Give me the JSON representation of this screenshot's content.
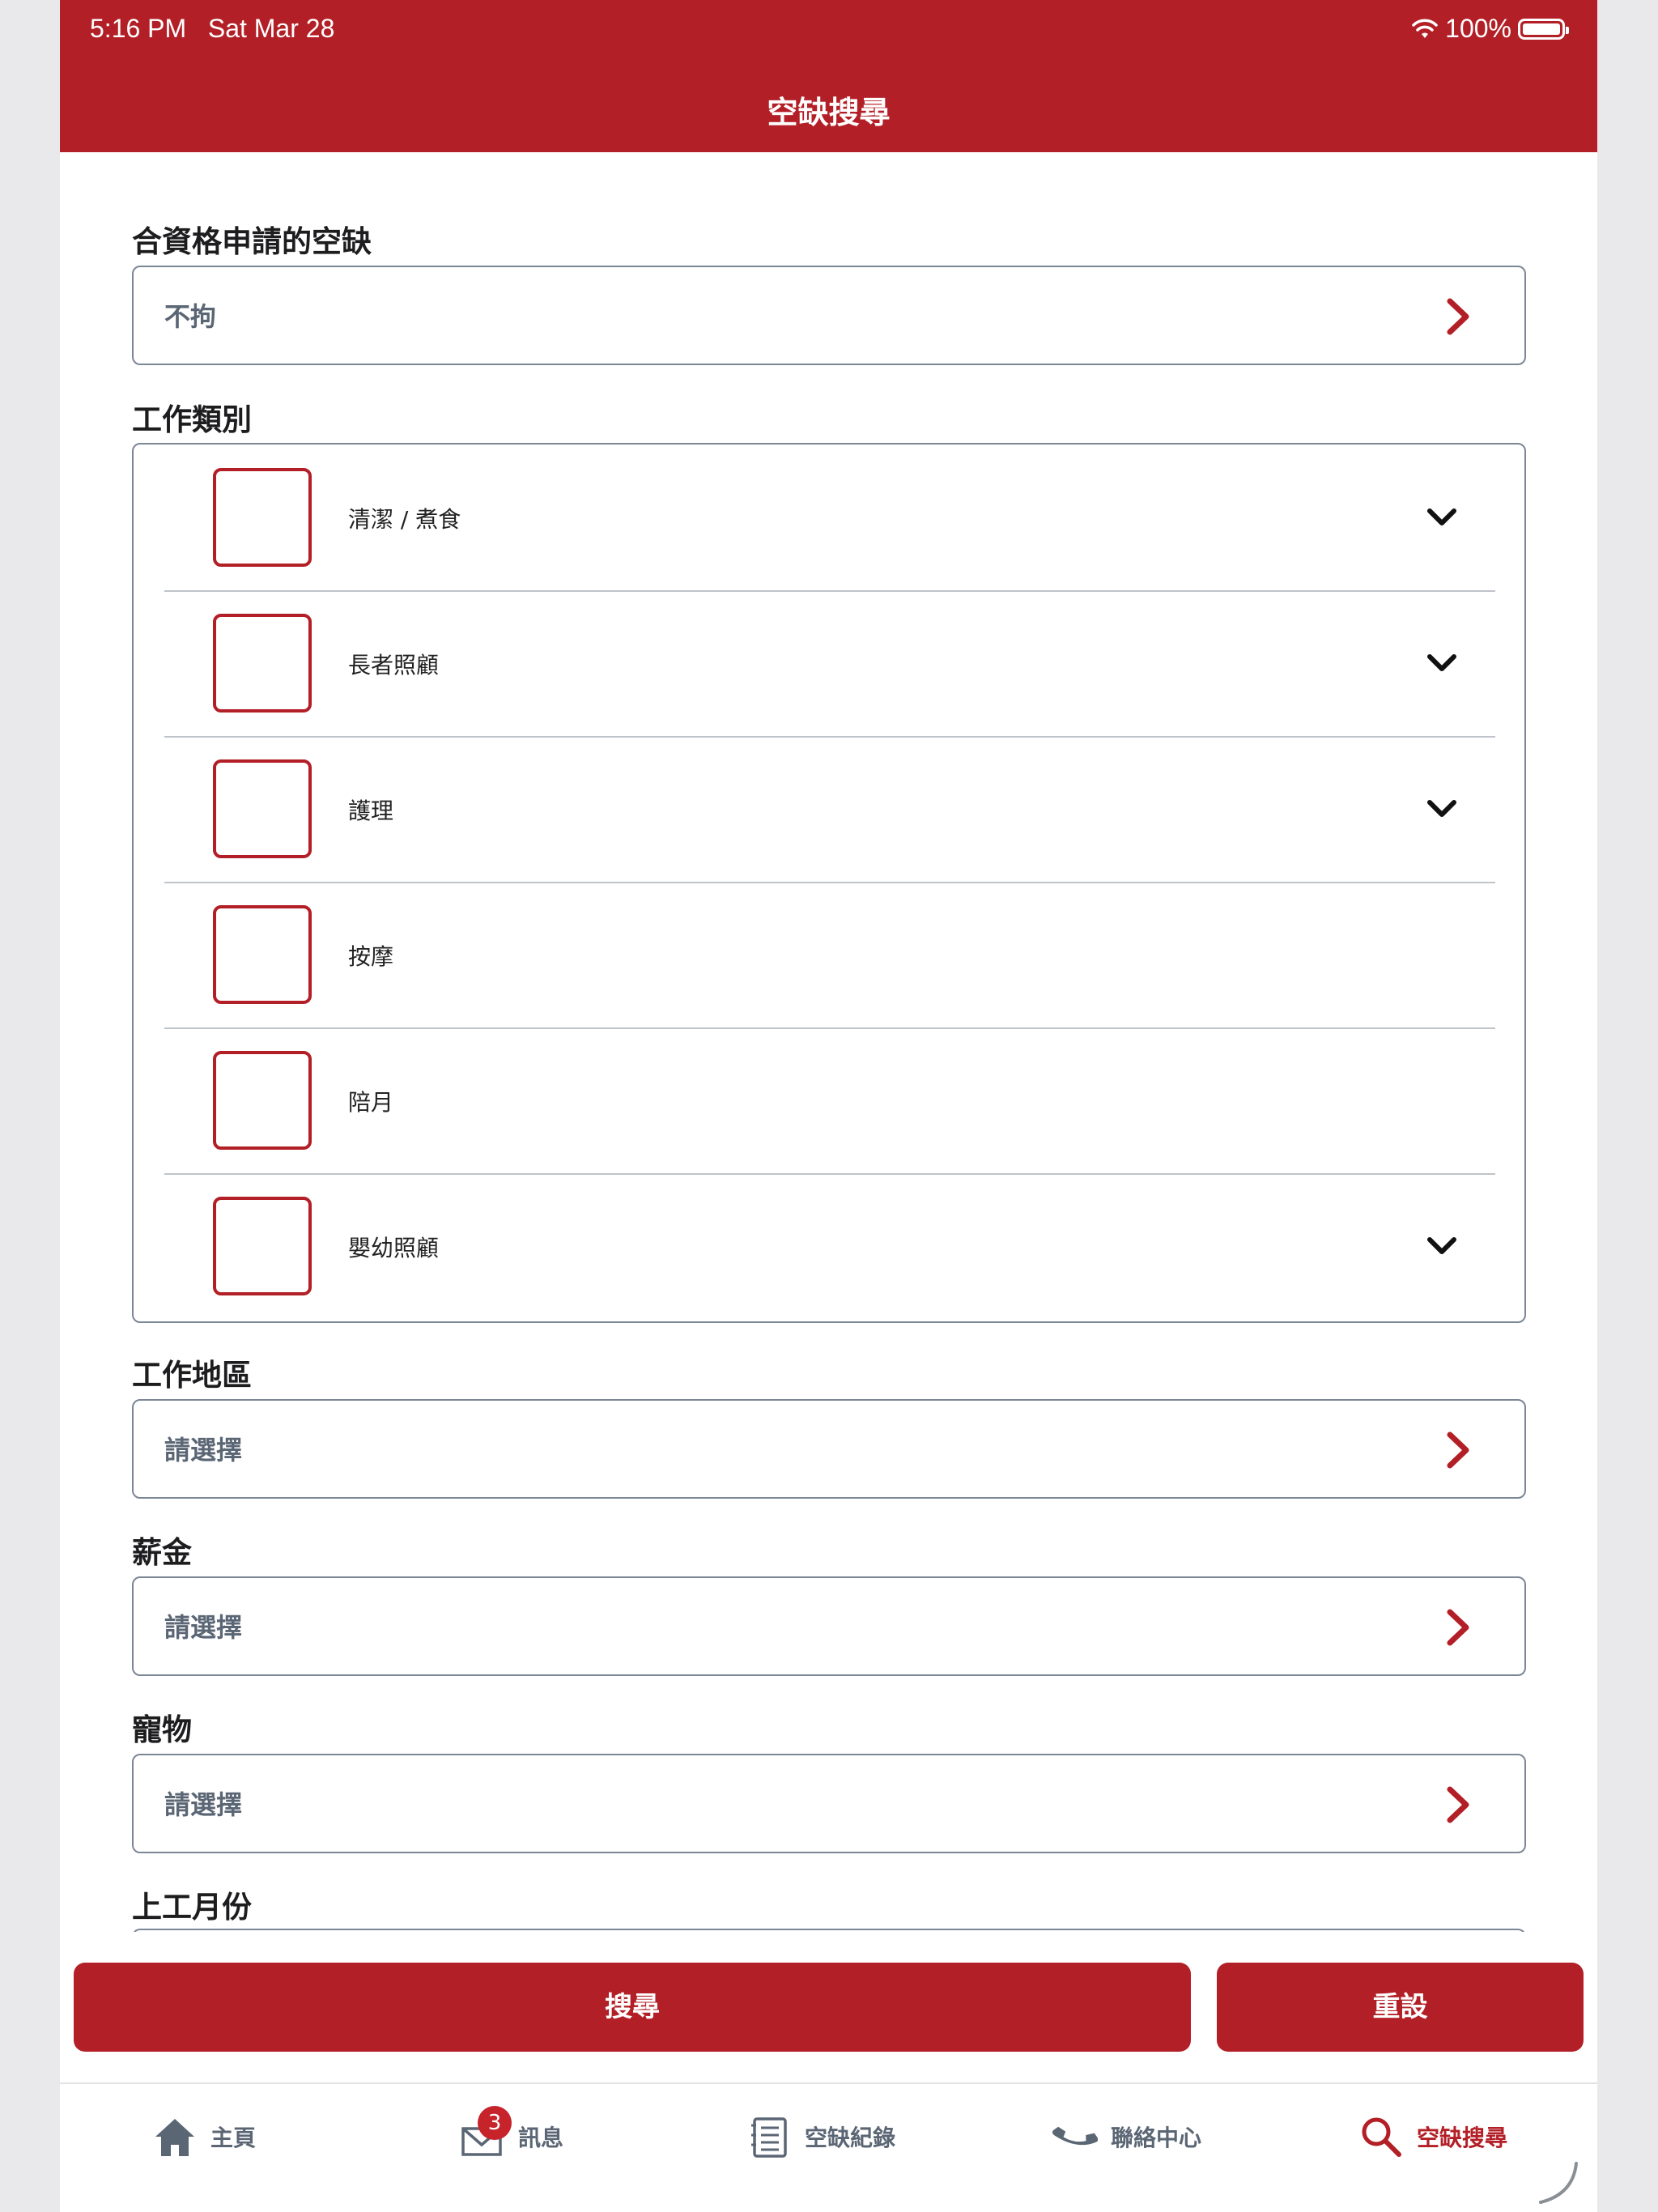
{
  "status_bar": {
    "time": "5:16 PM",
    "date": "Sat Mar 28",
    "battery": "100%"
  },
  "nav": {
    "title": "空缺搜尋"
  },
  "eligible": {
    "label": "合資格申請的空缺",
    "value": "不拘"
  },
  "categories": {
    "label": "工作類別",
    "items": [
      {
        "label": "清潔 / 煮食",
        "expandable": true
      },
      {
        "label": "長者照顧",
        "expandable": true
      },
      {
        "label": "護理",
        "expandable": true
      },
      {
        "label": "按摩",
        "expandable": false
      },
      {
        "label": "陪月",
        "expandable": false
      },
      {
        "label": "嬰幼照顧",
        "expandable": true
      }
    ]
  },
  "area": {
    "label": "工作地區",
    "value": "請選擇"
  },
  "salary": {
    "label": "薪金",
    "value": "請選擇"
  },
  "pet": {
    "label": "寵物",
    "value": "請選擇"
  },
  "start_month": {
    "label": "上工月份"
  },
  "actions": {
    "search": "搜尋",
    "reset": "重設"
  },
  "tabs": {
    "home": "主頁",
    "messages": "訊息",
    "messages_badge": "3",
    "records": "空缺紀錄",
    "contact": "聯絡中心",
    "search": "空缺搜尋"
  },
  "colors": {
    "brand": "#b31f26",
    "muted": "#5b6675"
  }
}
